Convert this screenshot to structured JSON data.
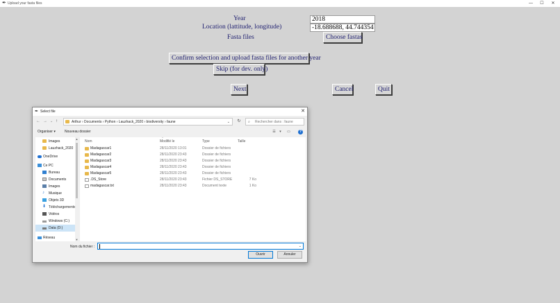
{
  "window": {
    "title": "Upload your fasta files"
  },
  "form": {
    "year_label": "Year",
    "year_value": "2018",
    "location_label": "Location (lattitude, longitude)",
    "location_value": "-18.688688, 44.744354",
    "fasta_label": "Fasta files",
    "choose_button": "Choose fastas",
    "confirm_button": "Confirm selection and upload fasta files for another year",
    "skip_button": "Skip (for dev. only)",
    "next_button": "Next",
    "cancel_button": "Cancel",
    "quit_button": "Quit"
  },
  "dialog": {
    "title": "Select file",
    "breadcrumb": "Arthur  ›  Documents  ›  Python  ›  Lauzhack_2020  ›  biodiversity  ›  faune",
    "search_placeholder": "Rechercher dans : faune",
    "toolbar": {
      "organize": "Organiser ▾",
      "new_folder": "Nouveau dossier"
    },
    "sidebar": [
      {
        "label": "Images",
        "icon": "folder-icon"
      },
      {
        "label": "Lauzhack_2020",
        "icon": "folder-icon"
      },
      {
        "label": "OneDrive",
        "icon": "cloud-icon"
      },
      {
        "label": "Ce PC",
        "icon": "computer-icon"
      },
      {
        "label": "Bureau",
        "icon": "desktop-icon"
      },
      {
        "label": "Documents",
        "icon": "documents-icon"
      },
      {
        "label": "Images",
        "icon": "pictures-icon"
      },
      {
        "label": "Musique",
        "icon": "music-icon"
      },
      {
        "label": "Objets 3D",
        "icon": "cube-icon"
      },
      {
        "label": "Téléchargements",
        "icon": "download-icon"
      },
      {
        "label": "Vidéos",
        "icon": "video-icon"
      },
      {
        "label": "Windows (C:)",
        "icon": "drive-icon"
      },
      {
        "label": "Data (D:)",
        "icon": "drive-icon"
      },
      {
        "label": "Réseau",
        "icon": "network-icon"
      }
    ],
    "columns": {
      "name": "Nom",
      "date": "Modifié le",
      "type": "Type",
      "size": "Taille"
    },
    "files": [
      {
        "name": "Madagascar1",
        "date": "28/11/2020 13:01",
        "type": "Dossier de fichiers",
        "size": "",
        "icon": "folder-icon"
      },
      {
        "name": "Madagascar2",
        "date": "28/11/2020 23:43",
        "type": "Dossier de fichiers",
        "size": "",
        "icon": "folder-icon"
      },
      {
        "name": "Madagascar3",
        "date": "28/11/2020 23:43",
        "type": "Dossier de fichiers",
        "size": "",
        "icon": "folder-icon"
      },
      {
        "name": "Madagascar4",
        "date": "28/11/2020 23:43",
        "type": "Dossier de fichiers",
        "size": "",
        "icon": "folder-icon"
      },
      {
        "name": "Madagascar5",
        "date": "28/11/2020 23:43",
        "type": "Dossier de fichiers",
        "size": "",
        "icon": "folder-icon"
      },
      {
        "name": ".DS_Store",
        "date": "28/11/2020 23:43",
        "type": "Fichier DS_STORE",
        "size": "7 Ko",
        "icon": "file-icon"
      },
      {
        "name": "madagascar.txt",
        "date": "28/11/2020 23:43",
        "type": "Document texte",
        "size": "1 Ko",
        "icon": "text-file-icon"
      }
    ],
    "filename_label": "Nom du fichier :",
    "filename_value": "",
    "open_button": "Ouvrir",
    "cancel_button": "Annuler"
  },
  "colors": {
    "background": "#d3d3d3",
    "label_text": "#1c1c6e",
    "accent": "#0078d7",
    "folder": "#e8b84a"
  }
}
